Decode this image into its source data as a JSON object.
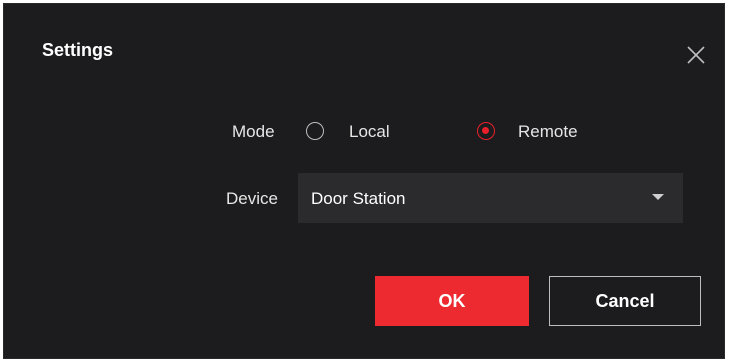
{
  "dialog": {
    "title": "Settings"
  },
  "mode": {
    "label": "Mode",
    "options": [
      {
        "label": "Local",
        "selected": false
      },
      {
        "label": "Remote",
        "selected": true
      }
    ]
  },
  "device": {
    "label": "Device",
    "selected_value": "Door Station"
  },
  "buttons": {
    "ok_label": "OK",
    "cancel_label": "Cancel"
  },
  "colors": {
    "background": "#1c1c1e",
    "accent": "#ec2a2f",
    "select_bg": "#2b2b2d"
  },
  "icons": {
    "close": "close-icon",
    "dropdown": "chevron-down-icon"
  }
}
